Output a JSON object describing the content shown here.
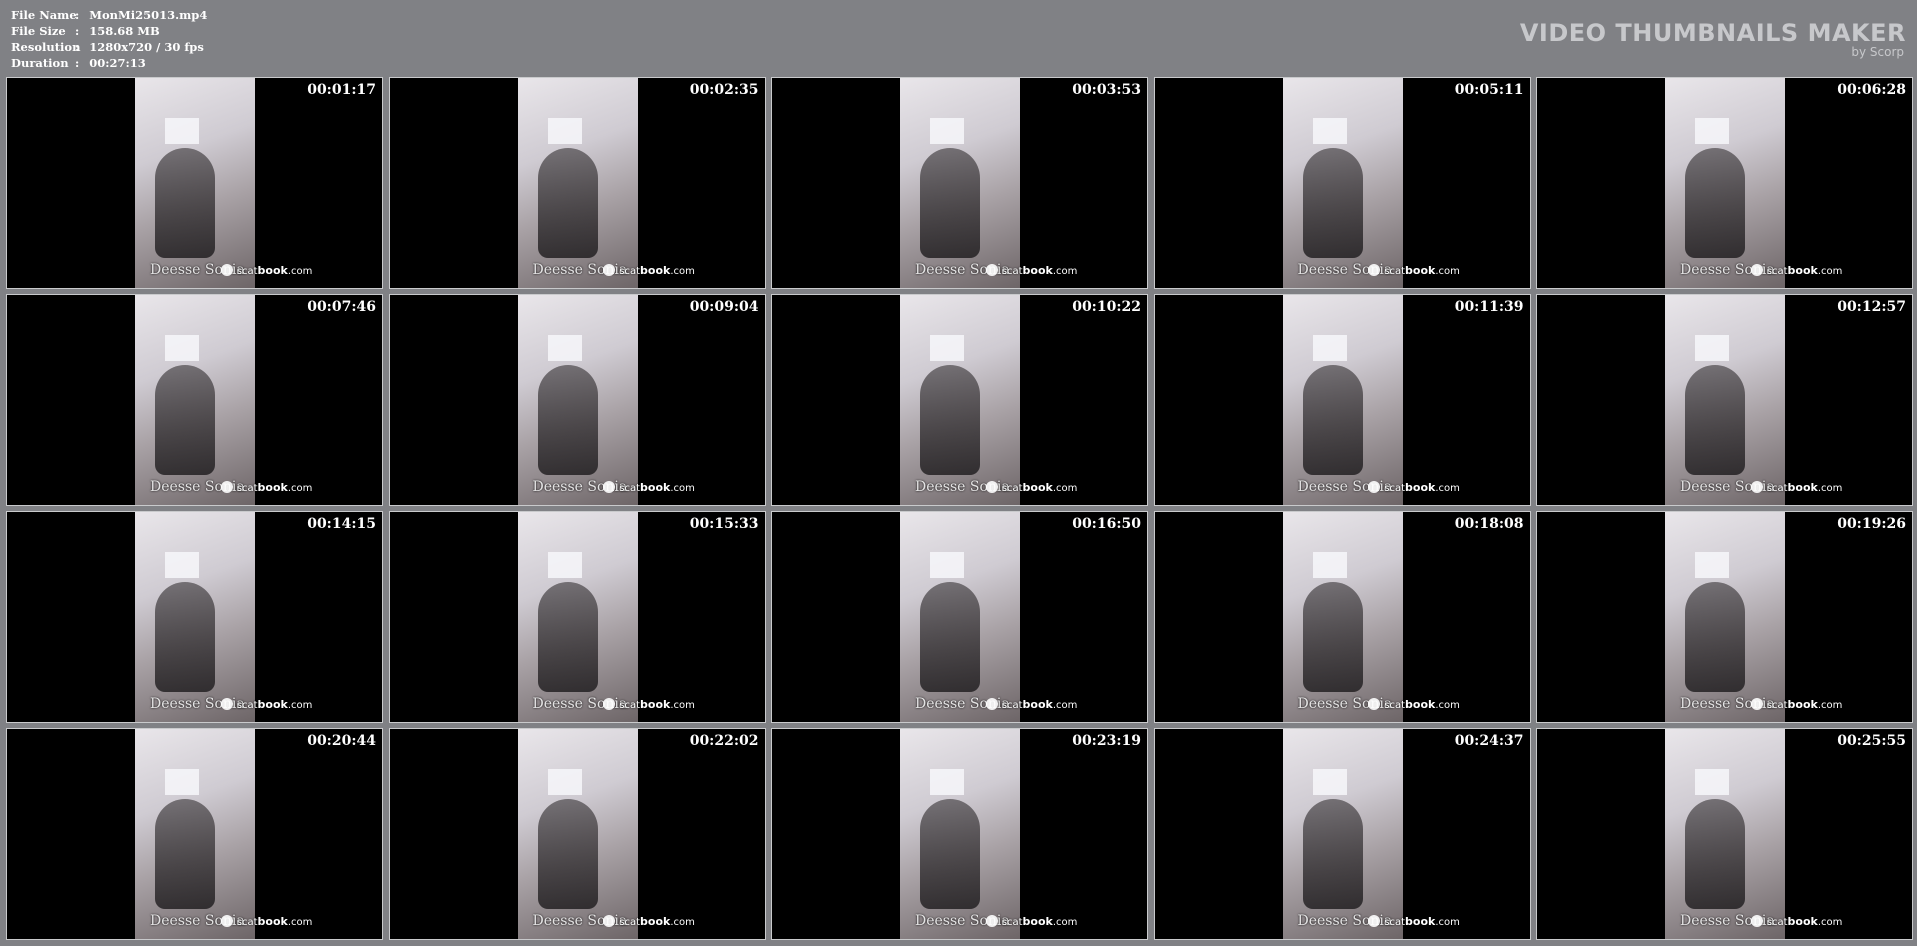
{
  "file_info": [
    {
      "label": "File Name",
      "value": "MonMi25013.mp4"
    },
    {
      "label": "File Size",
      "value": "158.68 MB"
    },
    {
      "label": "Resolution",
      "value": "1280x720 / 30 fps"
    },
    {
      "label": "Duration",
      "value": "00:27:13"
    }
  ],
  "separator": ":",
  "brand": {
    "title": "VIDEO THUMBNAILS MAKER",
    "subtitle": "by Scorp"
  },
  "watermark": {
    "name": "Deesse Sonia",
    "site_prefix": "scat",
    "site_bold": "book",
    "site_suffix": ".com"
  },
  "thumbnails": [
    {
      "timestamp": "00:01:17"
    },
    {
      "timestamp": "00:02:35"
    },
    {
      "timestamp": "00:03:53"
    },
    {
      "timestamp": "00:05:11"
    },
    {
      "timestamp": "00:06:28"
    },
    {
      "timestamp": "00:07:46"
    },
    {
      "timestamp": "00:09:04"
    },
    {
      "timestamp": "00:10:22"
    },
    {
      "timestamp": "00:11:39"
    },
    {
      "timestamp": "00:12:57"
    },
    {
      "timestamp": "00:14:15"
    },
    {
      "timestamp": "00:15:33"
    },
    {
      "timestamp": "00:16:50"
    },
    {
      "timestamp": "00:18:08"
    },
    {
      "timestamp": "00:19:26"
    },
    {
      "timestamp": "00:20:44"
    },
    {
      "timestamp": "00:22:02"
    },
    {
      "timestamp": "00:23:19"
    },
    {
      "timestamp": "00:24:37"
    },
    {
      "timestamp": "00:25:55"
    }
  ]
}
